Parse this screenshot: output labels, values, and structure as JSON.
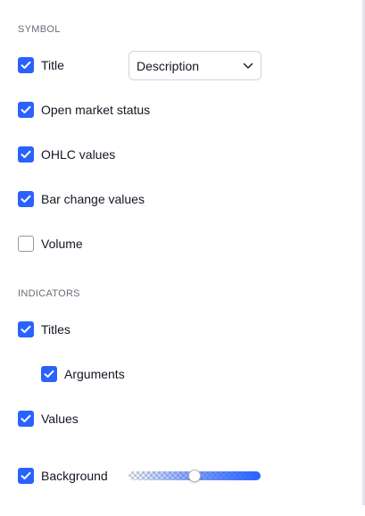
{
  "sections": {
    "symbol_title": "SYMBOL",
    "indicators_title": "INDICATORS"
  },
  "items": {
    "title": {
      "label": "Title",
      "checked": true
    },
    "open_market_status": {
      "label": "Open market status",
      "checked": true
    },
    "ohlc_values": {
      "label": "OHLC values",
      "checked": true
    },
    "bar_change_values": {
      "label": "Bar change values",
      "checked": true
    },
    "volume": {
      "label": "Volume",
      "checked": false
    },
    "titles": {
      "label": "Titles",
      "checked": true
    },
    "arguments": {
      "label": "Arguments",
      "checked": true
    },
    "values": {
      "label": "Values",
      "checked": true
    },
    "background": {
      "label": "Background",
      "checked": true
    }
  },
  "title_select": {
    "value": "Description",
    "icon": "chevron-down-icon"
  },
  "background_opacity": {
    "value": 0.5
  },
  "colors": {
    "accent": "#2962ff",
    "text": "#131722",
    "section": "#6a6d78",
    "border": "#d1d4dc"
  }
}
